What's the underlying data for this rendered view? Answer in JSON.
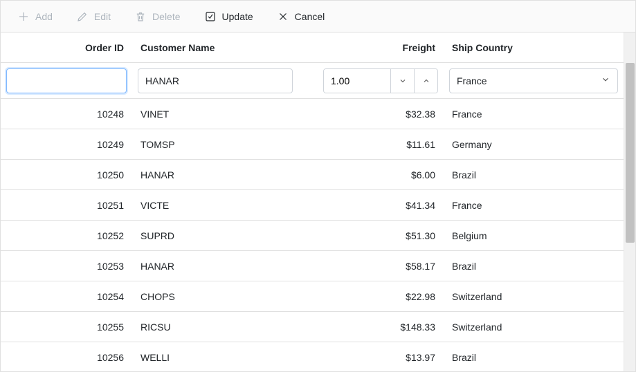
{
  "toolbar": {
    "add": "Add",
    "edit": "Edit",
    "delete": "Delete",
    "update": "Update",
    "cancel": "Cancel"
  },
  "headers": {
    "orderid": "Order ID",
    "customer": "Customer Name",
    "freight": "Freight",
    "ship": "Ship Country"
  },
  "edit": {
    "orderid": "",
    "customer": "HANAR",
    "freight": "1.00",
    "ship": "France"
  },
  "rows": [
    {
      "orderid": "10248",
      "customer": "VINET",
      "freight": "$32.38",
      "ship": "France"
    },
    {
      "orderid": "10249",
      "customer": "TOMSP",
      "freight": "$11.61",
      "ship": "Germany"
    },
    {
      "orderid": "10250",
      "customer": "HANAR",
      "freight": "$6.00",
      "ship": "Brazil"
    },
    {
      "orderid": "10251",
      "customer": "VICTE",
      "freight": "$41.34",
      "ship": "France"
    },
    {
      "orderid": "10252",
      "customer": "SUPRD",
      "freight": "$51.30",
      "ship": "Belgium"
    },
    {
      "orderid": "10253",
      "customer": "HANAR",
      "freight": "$58.17",
      "ship": "Brazil"
    },
    {
      "orderid": "10254",
      "customer": "CHOPS",
      "freight": "$22.98",
      "ship": "Switzerland"
    },
    {
      "orderid": "10255",
      "customer": "RICSU",
      "freight": "$148.33",
      "ship": "Switzerland"
    },
    {
      "orderid": "10256",
      "customer": "WELLI",
      "freight": "$13.97",
      "ship": "Brazil"
    }
  ]
}
